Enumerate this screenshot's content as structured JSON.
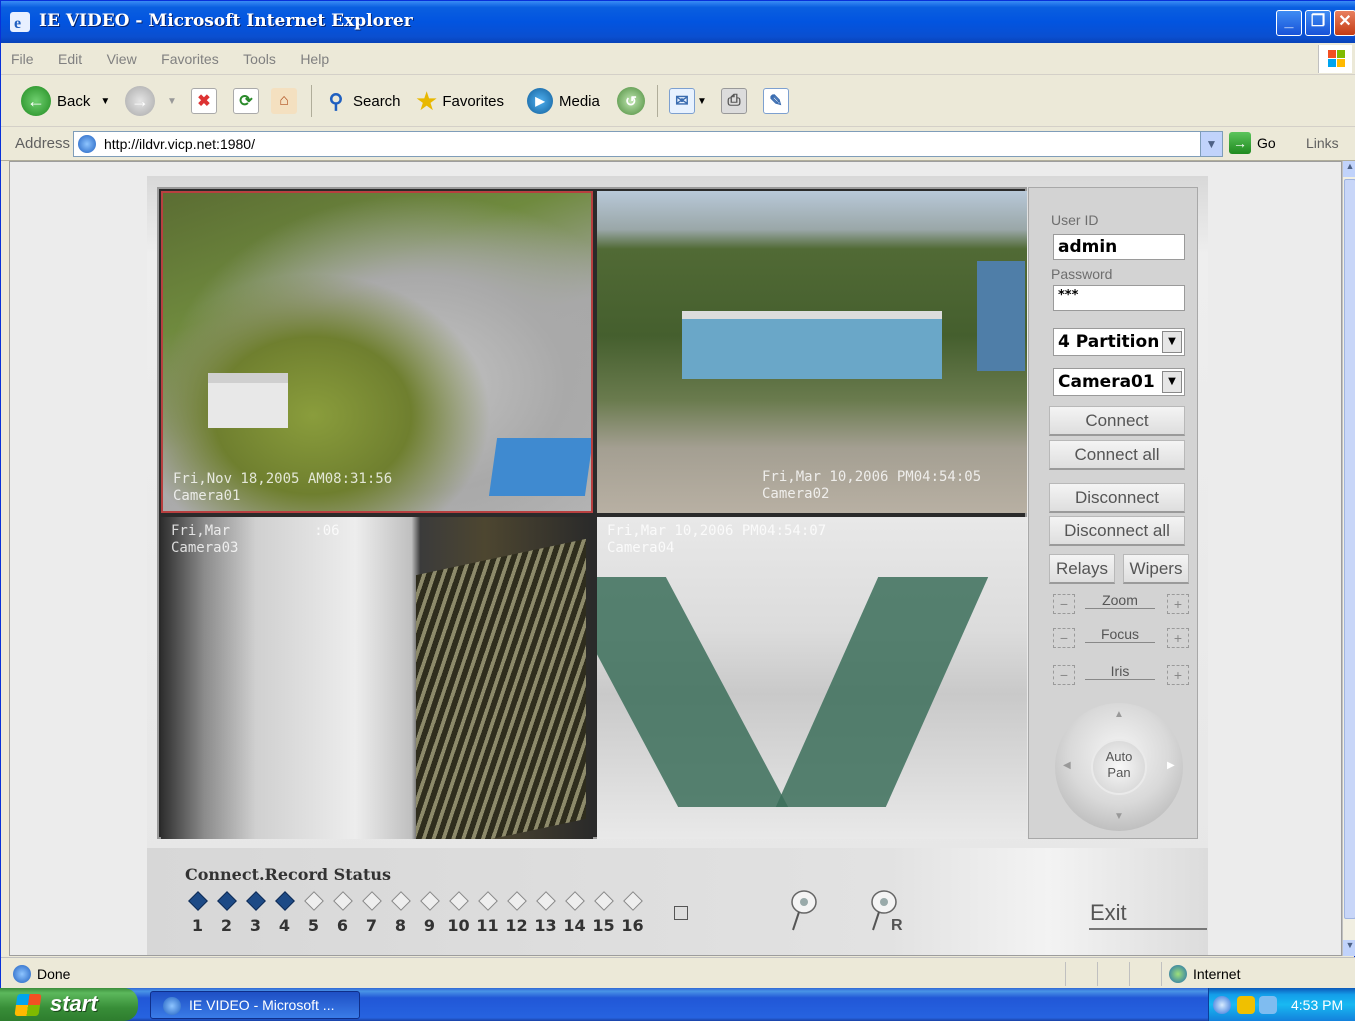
{
  "window": {
    "title": "IE VIDEO - Microsoft Internet Explorer",
    "buttons": {
      "minimize": "_",
      "maximize": "❐",
      "close": "✕"
    }
  },
  "menu": [
    "File",
    "Edit",
    "View",
    "Favorites",
    "Tools",
    "Help"
  ],
  "toolbar": {
    "back_label": "Back",
    "search_label": "Search",
    "favorites_label": "Favorites",
    "media_label": "Media"
  },
  "address": {
    "label": "Address",
    "url": "http://ildvr.vicp.net:1980/",
    "go_label": "Go",
    "links_label": "Links"
  },
  "cameras": [
    {
      "timestamp": "Fri,Nov 18,2005 AM08:31:56",
      "name": "Camera01"
    },
    {
      "timestamp": "Fri,Mar 10,2006 PM04:54:05",
      "name": "Camera02"
    },
    {
      "timestamp": "Fri,Mar          :06",
      "name": "Camera03"
    },
    {
      "timestamp": "Fri,Mar 10,2006 PM04:54:07",
      "name": "Camera04"
    }
  ],
  "login": {
    "user_label": "User ID",
    "user_value": "admin",
    "password_label": "Password",
    "password_value": "***"
  },
  "selects": {
    "partition": "4 Partition",
    "camera": "Camera01"
  },
  "buttons": {
    "connect": "Connect",
    "connect_all": "Connect all",
    "disconnect": "Disconnect",
    "disconnect_all": "Disconnect all",
    "relays": "Relays",
    "wipers": "Wipers"
  },
  "lens": {
    "zoom": "Zoom",
    "focus": "Focus",
    "iris": "Iris"
  },
  "ptz": {
    "center_line1": "Auto",
    "center_line2": "Pan"
  },
  "status": {
    "title": "Connect.Record Status",
    "channels": [
      {
        "n": "1",
        "on": true
      },
      {
        "n": "2",
        "on": true
      },
      {
        "n": "3",
        "on": true
      },
      {
        "n": "4",
        "on": true
      },
      {
        "n": "5",
        "on": false
      },
      {
        "n": "6",
        "on": false
      },
      {
        "n": "7",
        "on": false
      },
      {
        "n": "8",
        "on": false
      },
      {
        "n": "9",
        "on": false
      },
      {
        "n": "10",
        "on": false
      },
      {
        "n": "11",
        "on": false
      },
      {
        "n": "12",
        "on": false
      },
      {
        "n": "13",
        "on": false
      },
      {
        "n": "14",
        "on": false
      },
      {
        "n": "15",
        "on": false
      },
      {
        "n": "16",
        "on": false
      }
    ],
    "record_icon_letter": "R",
    "exit_label": "Exit"
  },
  "statusbar": {
    "status_text": "Done",
    "zone_text": "Internet"
  },
  "taskbar": {
    "start_label": "start",
    "task_label": "IE VIDEO - Microsoft ...",
    "clock": "4:53 PM"
  }
}
